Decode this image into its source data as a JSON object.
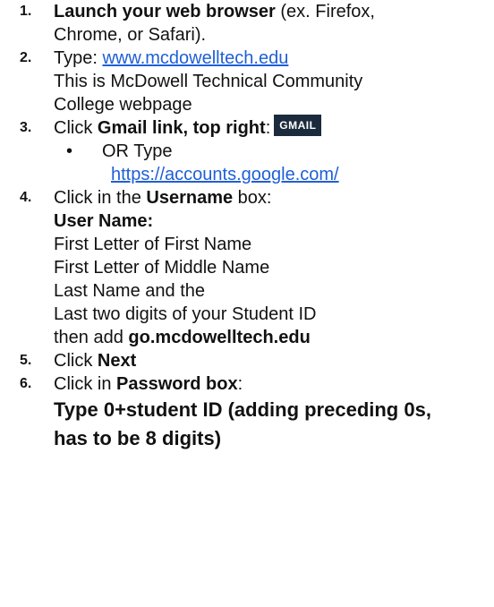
{
  "steps": [
    {
      "number": "1.",
      "bold_lead": "Launch your web browser",
      "text_rest": " (ex. Firefox,",
      "line2": "Chrome, or Safari)."
    },
    {
      "number": "2.",
      "prefix": "Type: ",
      "url": "www.mcdowelltech.edu ",
      "line2": "This is McDowell Technical Community",
      "line3": "College webpage"
    },
    {
      "number": "3.",
      "prefix": "Click ",
      "bold": "Gmail link, top right",
      "suffix": ":",
      "logo_text": "GMAIL",
      "sub": {
        "bullet": "•",
        "line1": "OR Type",
        "url": "https://accounts.google.com/"
      }
    },
    {
      "number": "4.",
      "prefix": "Click in the ",
      "bold": "Username",
      "suffix": " box:",
      "heading": "User Name:",
      "lines": [
        "First Letter of First Name",
        "First Letter of Middle Name",
        "Last Name and the",
        "Last two digits of your Student ID"
      ],
      "final_prefix": "then add ",
      "final_bold": "go.mcdowelltech.edu"
    },
    {
      "number": "5.",
      "prefix": "Click ",
      "bold": "Next"
    },
    {
      "number": "6.",
      "prefix": "Click in ",
      "bold": "Password box",
      "suffix": ":",
      "line2": "Type 0+student ID (adding preceding 0s,",
      "line3": "has to be 8 digits)"
    }
  ]
}
